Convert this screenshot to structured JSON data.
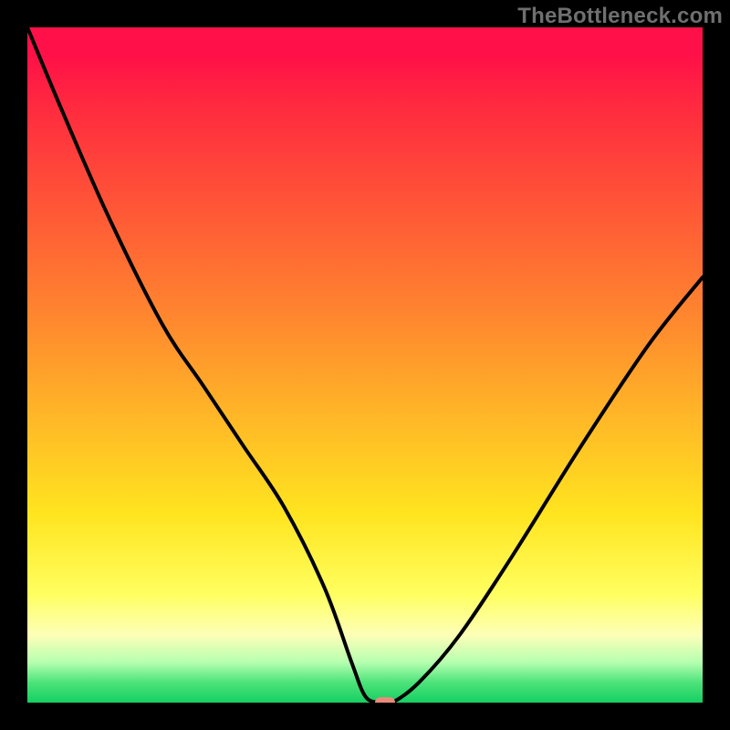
{
  "attribution": "TheBottleneck.com",
  "colors": {
    "page_bg": "#000000",
    "curve": "#000000",
    "marker": "#ea8a7d",
    "attribution_text": "#6f6f6f"
  },
  "chart_data": {
    "type": "line",
    "title": "",
    "xlabel": "",
    "ylabel": "",
    "xlim": [
      0,
      100
    ],
    "ylim": [
      0,
      100
    ],
    "grid": false,
    "legend": false,
    "annotations": [
      "TheBottleneck.com"
    ],
    "background_gradient_stops": [
      {
        "pos": 0.0,
        "color": "#ff1048"
      },
      {
        "pos": 0.12,
        "color": "#ff2b3f"
      },
      {
        "pos": 0.28,
        "color": "#ff5a36"
      },
      {
        "pos": 0.44,
        "color": "#ff8a2e"
      },
      {
        "pos": 0.58,
        "color": "#ffb827"
      },
      {
        "pos": 0.72,
        "color": "#ffe41f"
      },
      {
        "pos": 0.84,
        "color": "#ffff60"
      },
      {
        "pos": 0.9,
        "color": "#fdffb8"
      },
      {
        "pos": 0.94,
        "color": "#b7ffb0"
      },
      {
        "pos": 0.97,
        "color": "#4de37a"
      },
      {
        "pos": 1.0,
        "color": "#15cf62"
      }
    ],
    "series": [
      {
        "name": "bottleneck-curve",
        "x": [
          0,
          5,
          12,
          20,
          26,
          32,
          38,
          44,
          48,
          50,
          52,
          54,
          58,
          64,
          72,
          82,
          92,
          100
        ],
        "y": [
          100,
          88,
          72,
          56,
          47,
          38,
          29,
          17,
          6,
          1,
          0,
          0,
          3,
          10,
          22,
          38,
          53,
          63
        ]
      }
    ],
    "marker": {
      "x": 53,
      "y": 0,
      "shape": "rounded-rect",
      "color": "#ea8a7d"
    }
  }
}
